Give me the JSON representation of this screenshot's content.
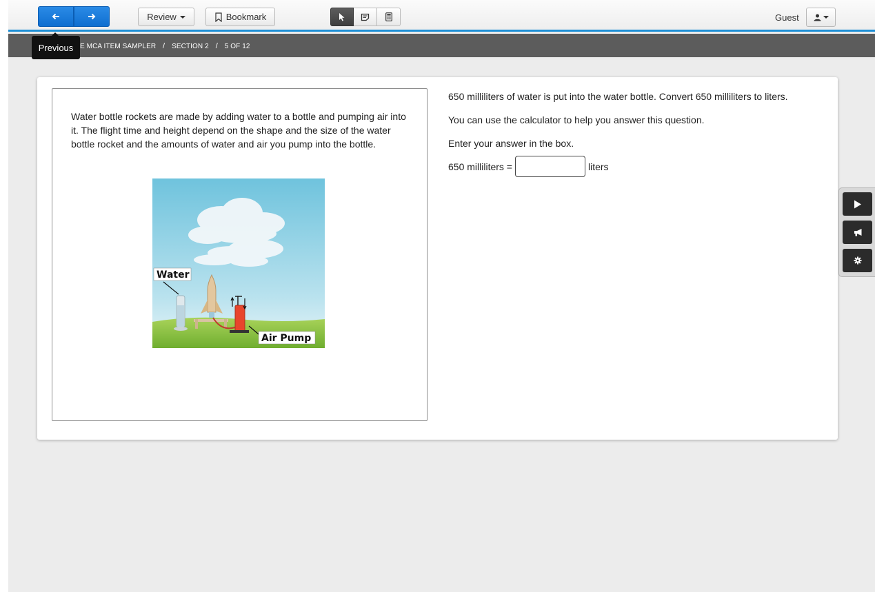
{
  "toolbar": {
    "prev_tooltip": "Previous",
    "review_label": "Review",
    "bookmark_label": "Bookmark",
    "user_label": "Guest"
  },
  "breadcrumb": {
    "test": "E MCA ITEM SAMPLER",
    "section": "SECTION 2",
    "position": "5 OF 12"
  },
  "passage": {
    "text": "Water bottle rockets are made by adding water to a bottle and pumping air into it. The flight time and height depend on the shape and the size of the water bottle rocket and the amounts of water and air you pump into the bottle.",
    "image_labels": {
      "water": "Water",
      "air_pump": "Air Pump"
    }
  },
  "question": {
    "prompt": "650 milliliters of water is put into the water bottle. Convert 650 milliliters to liters.",
    "calculator_note": "You can use the calculator to help you answer this question.",
    "instruction": "Enter your answer in the box.",
    "answer_prefix": "650 milliliters =",
    "answer_value": "",
    "answer_suffix": "liters"
  },
  "colors": {
    "accent": "#1e8fd6",
    "nav_button": "#1a7ddb",
    "crumb_bar": "#5c5c5c",
    "active_tool": "#4a4a4a"
  },
  "icons": {
    "prev": "arrow-left-icon",
    "next": "arrow-right-icon",
    "bookmark": "bookmark-icon",
    "pointer": "pointer-icon",
    "notes": "notes-icon",
    "calculator": "calculator-icon",
    "user": "user-icon",
    "play": "play-icon",
    "megaphone": "megaphone-icon",
    "settings": "gear-icon"
  }
}
